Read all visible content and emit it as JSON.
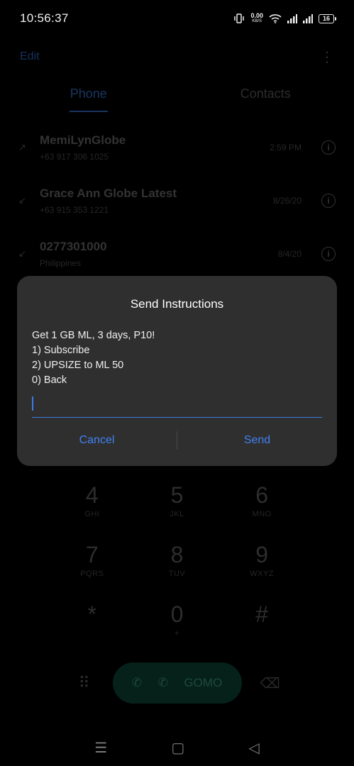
{
  "status": {
    "time": "10:56:37",
    "net_speed": "0.00",
    "net_unit": "KB/S",
    "battery": "16"
  },
  "header": {
    "edit": "Edit"
  },
  "tabs": [
    {
      "label": "Phone"
    },
    {
      "label": "Contacts"
    }
  ],
  "calls": [
    {
      "name": "MemiLynGlobe",
      "sub": "+63 917 306 1025",
      "time": "2:59 PM"
    },
    {
      "name": "Grace Ann Globe Latest",
      "sub": "+63 915 353 1221",
      "time": "8/26/20"
    },
    {
      "name": "0277301000",
      "sub": "Philippines",
      "time": "8/4/20"
    }
  ],
  "keypad": [
    {
      "num": "4",
      "letters": "GHI"
    },
    {
      "num": "5",
      "letters": "JKL"
    },
    {
      "num": "6",
      "letters": "MNO"
    },
    {
      "num": "7",
      "letters": "PQRS"
    },
    {
      "num": "8",
      "letters": "TUV"
    },
    {
      "num": "9",
      "letters": "WXYZ"
    },
    {
      "num": "*",
      "letters": ""
    },
    {
      "num": "0",
      "letters": "+"
    },
    {
      "num": "#",
      "letters": ""
    }
  ],
  "call_pill": {
    "label": "GOMO"
  },
  "dialog": {
    "title": "Send Instructions",
    "lines": [
      "Get 1 GB ML, 3 days, P10!",
      "1) Subscribe",
      "2) UPSIZE to ML 50",
      "0) Back"
    ],
    "input_value": "",
    "cancel": "Cancel",
    "send": "Send"
  },
  "colors": {
    "accent": "#3f82f0",
    "dialog_bg": "#2f2f2f"
  }
}
